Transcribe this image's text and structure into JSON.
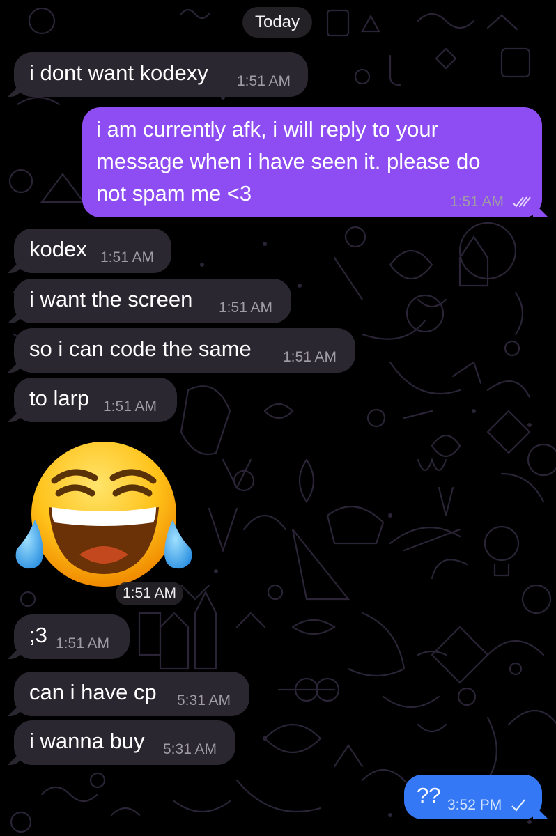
{
  "date_divider": "Today",
  "messages": [
    {
      "text": "i dont want kodexy",
      "time": "1:51 AM"
    },
    {
      "text_lines": [
        "i am currently afk, i will reply to your",
        "message when i have seen it. please do",
        "not spam me <3"
      ],
      "time": "1:51 AM",
      "status_icon": "double-check-icon"
    },
    {
      "text": "kodex",
      "time": "1:51 AM"
    },
    {
      "text": "i want the screen",
      "time": "1:51 AM"
    },
    {
      "text": "so i can code the same",
      "time": "1:51 AM"
    },
    {
      "text": "to larp",
      "time": "1:51 AM"
    },
    {
      "sticker": "tears-of-joy-emoji",
      "time": "1:51 AM"
    },
    {
      "text": ";3",
      "time": "1:51 AM"
    },
    {
      "text": "can i have cp",
      "time": "5:31 AM"
    },
    {
      "text": "i wanna buy",
      "time": "5:31 AM"
    },
    {
      "text": "??",
      "time": "3:52 PM",
      "status_icon": "check-icon"
    }
  ],
  "colors": {
    "background": "#000000",
    "incoming_bubble": "#2b2730",
    "outgoing_purple": "#8e4df2",
    "outgoing_blue": "#3478f6"
  }
}
